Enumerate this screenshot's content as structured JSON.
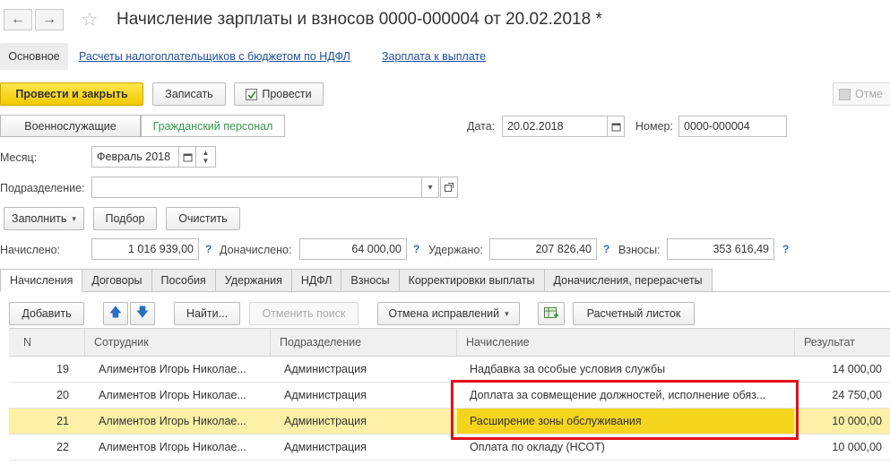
{
  "title": "Начисление зарплаты и взносов 0000-000004 от 20.02.2018 *",
  "nav": {
    "back": "←",
    "forward": "→",
    "star": "☆"
  },
  "links": {
    "main": "Основное",
    "link1": "Расчеты налогоплательщиков с бюджетом по НДФЛ",
    "link2": "Зарплата к выплате"
  },
  "toolbar": {
    "post_close": "Провести и закрыть",
    "save": "Записать",
    "post": "Провести",
    "cancel": "Отме"
  },
  "segments": {
    "military": "Военнослужащие",
    "civil": "Гражданский персонал"
  },
  "date": {
    "label": "Дата:",
    "value": "20.02.2018"
  },
  "number": {
    "label": "Номер:",
    "value": "0000-000004"
  },
  "month": {
    "label": "Месяц:",
    "value": "Февраль 2018"
  },
  "division": {
    "label": "Подразделение:",
    "value": ""
  },
  "actions": {
    "fill": "Заполнить",
    "pick": "Подбор",
    "clear": "Очистить"
  },
  "totals": {
    "accrued_label": "Начислено:",
    "accrued": "1 016 939,00",
    "extra_label": "Доначислено:",
    "extra": "64 000,00",
    "withheld_label": "Удержано:",
    "withheld": "207 826,40",
    "contrib_label": "Взносы:",
    "contrib": "353 616,49",
    "q": "?"
  },
  "tabs": [
    "Начисления",
    "Договоры",
    "Пособия",
    "Удержания",
    "НДФЛ",
    "Взносы",
    "Корректировки выплаты",
    "Доначисления, перерасчеты"
  ],
  "table_toolbar": {
    "add": "Добавить",
    "find": "Найти...",
    "cancel_search": "Отменить поиск",
    "cancel_fix": "Отмена исправлений",
    "payslip": "Расчетный листок"
  },
  "table": {
    "headers": {
      "n": "N",
      "employee": "Сотрудник",
      "division": "Подразделение",
      "accrual": "Начисление",
      "result": "Результат"
    },
    "rows": [
      {
        "n": "19",
        "employee": "Алиментов Игорь Николае...",
        "division": "Администрация",
        "accrual": "Надбавка за особые условия службы",
        "result": "14 000,00"
      },
      {
        "n": "20",
        "employee": "Алиментов Игорь Николае...",
        "division": "Администрация",
        "accrual": "Доплата за совмещение должностей, исполнение обяз...",
        "result": "24 750,00"
      },
      {
        "n": "21",
        "employee": "Алиментов Игорь Николае...",
        "division": "Администрация",
        "accrual": "Расширение зоны обслуживания",
        "result": "10 000,00"
      },
      {
        "n": "22",
        "employee": "Алиментов Игорь Николае...",
        "division": "Администрация",
        "accrual": "Оплата по окладу (НСОТ)",
        "result": "10 000,00"
      }
    ]
  }
}
